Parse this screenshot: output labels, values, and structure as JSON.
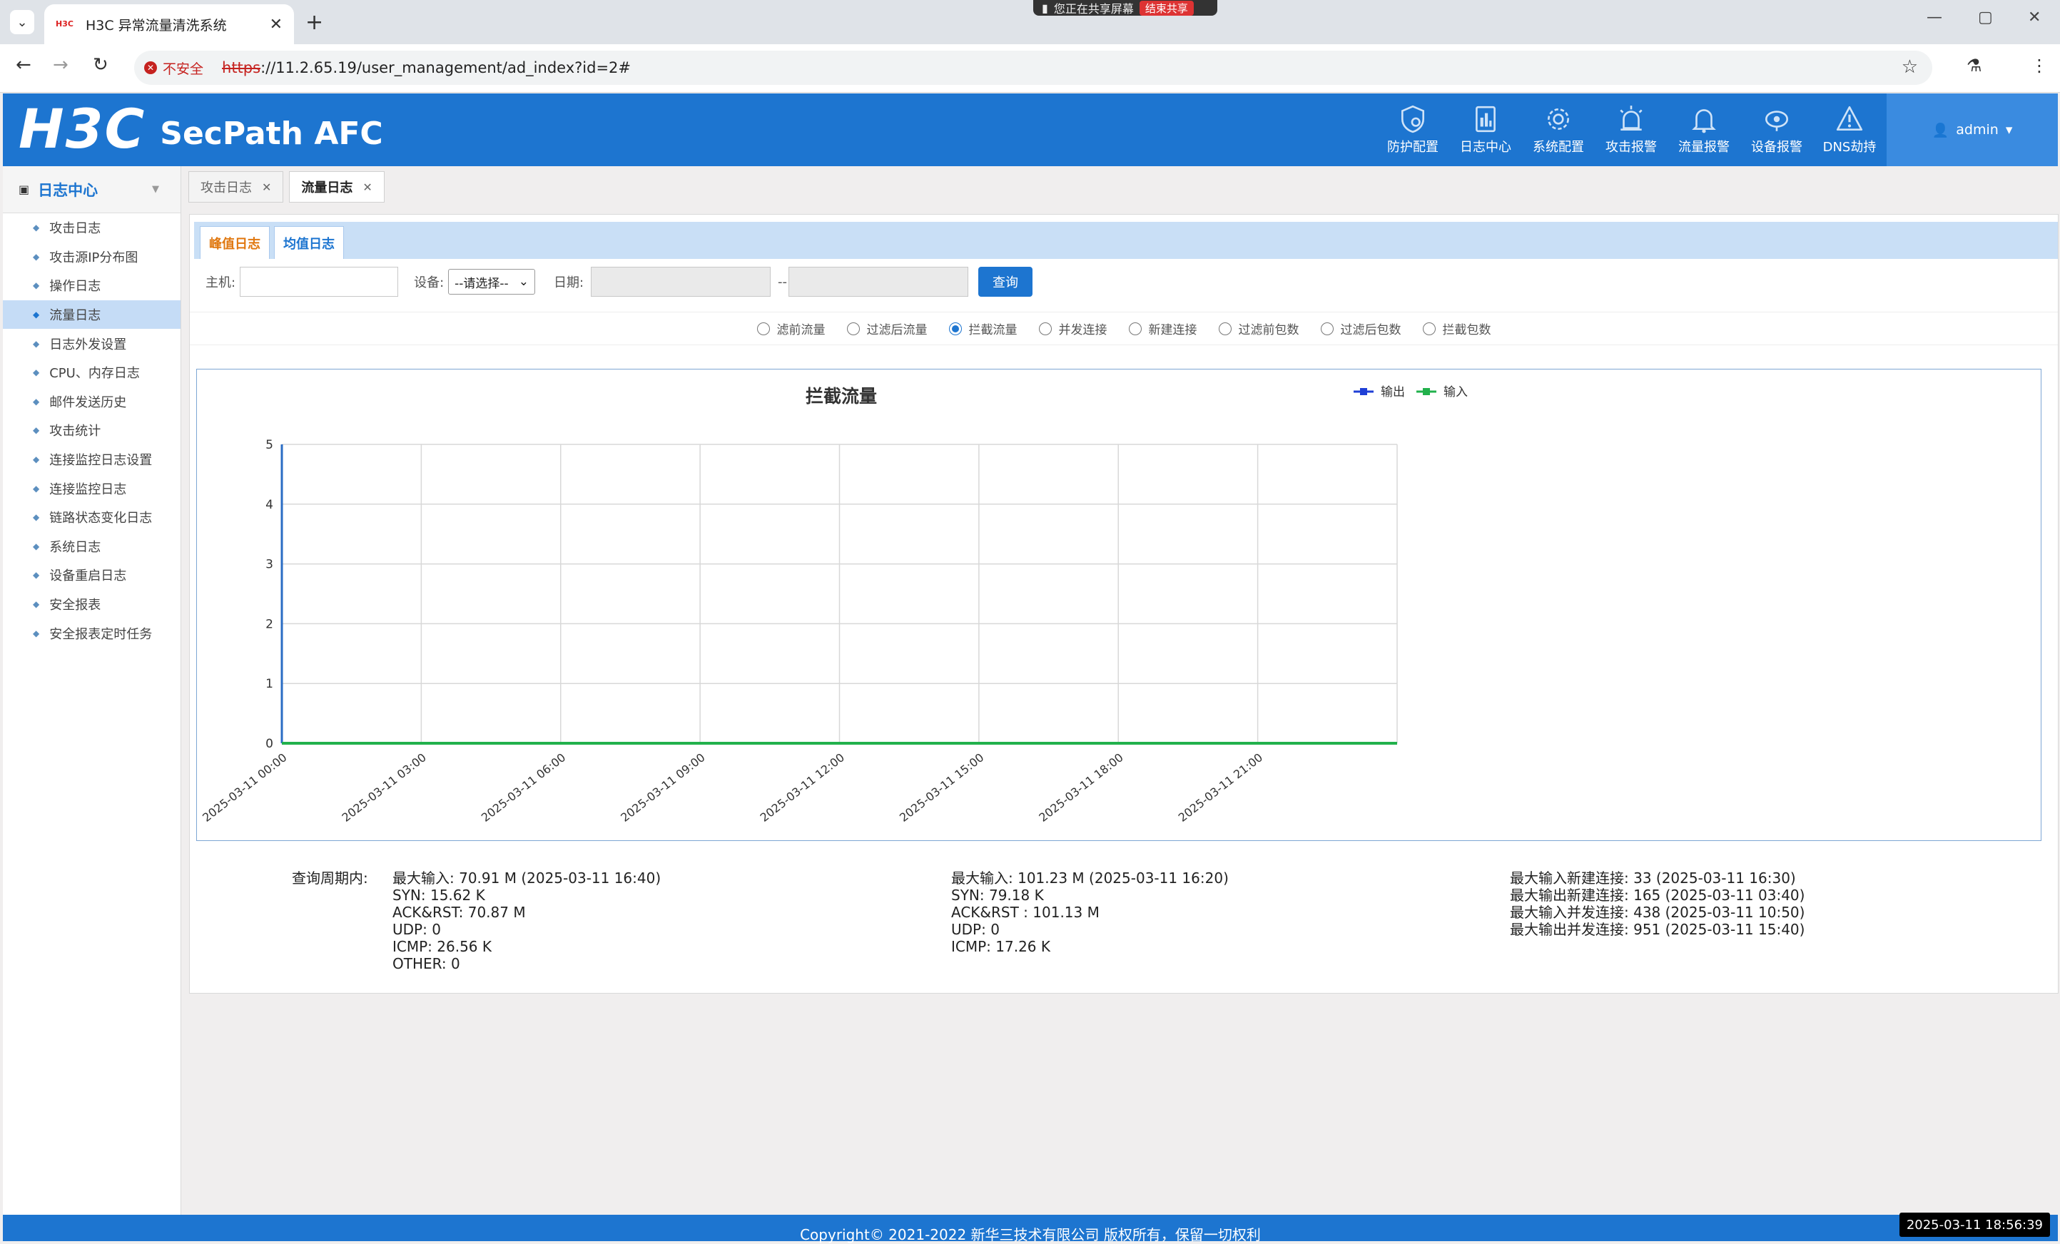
{
  "browser": {
    "tab_title": "H3C 异常流量清洗系统",
    "tab_favicon": "H3C",
    "new_tab": "+",
    "share_banner": "您正在共享屏幕",
    "share_stop": "结束共享",
    "insecure_label": "不安全",
    "url_scheme": "https",
    "url_rest": "://11.2.65.19/user_management/ad_index?id=2#"
  },
  "header": {
    "logo": "H3C",
    "product": "SecPath AFC",
    "nav": [
      {
        "label": "防护配置",
        "icon": "shield-gear-icon"
      },
      {
        "label": "日志中心",
        "icon": "log-book-icon"
      },
      {
        "label": "系统配置",
        "icon": "gear-icon"
      },
      {
        "label": "攻击报警",
        "icon": "alarm-light-icon"
      },
      {
        "label": "流量报警",
        "icon": "bell-icon"
      },
      {
        "label": "设备报警",
        "icon": "device-alert-icon"
      },
      {
        "label": "DNS劫持",
        "icon": "warning-triangle-icon"
      }
    ],
    "user": "admin"
  },
  "sidebar": {
    "title": "日志中心",
    "items": [
      {
        "label": "攻击日志"
      },
      {
        "label": "攻击源IP分布图"
      },
      {
        "label": "操作日志"
      },
      {
        "label": "流量日志"
      },
      {
        "label": "日志外发设置"
      },
      {
        "label": "CPU、内存日志"
      },
      {
        "label": "邮件发送历史"
      },
      {
        "label": "攻击统计"
      },
      {
        "label": "连接监控日志设置"
      },
      {
        "label": "连接监控日志"
      },
      {
        "label": "链路状态变化日志"
      },
      {
        "label": "系统日志"
      },
      {
        "label": "设备重启日志"
      },
      {
        "label": "安全报表"
      },
      {
        "label": "安全报表定时任务"
      }
    ],
    "active_index": 3
  },
  "page_tabs": [
    {
      "label": "攻击日志"
    },
    {
      "label": "流量日志"
    }
  ],
  "sub_tabs": [
    {
      "label": "峰值日志"
    },
    {
      "label": "均值日志"
    }
  ],
  "filters": {
    "host_label": "主机:",
    "host_value": "",
    "device_label": "设备:",
    "device_value": "--请选择--",
    "date_label": "日期:",
    "date_sep": "--",
    "date_from": "",
    "date_to": "",
    "query_button": "查询"
  },
  "radios": {
    "options": [
      "滤前流量",
      "过滤后流量",
      "拦截流量",
      "并发连接",
      "新建连接",
      "过滤前包数",
      "过滤后包数",
      "拦截包数"
    ],
    "selected_index": 2
  },
  "chart_data": {
    "type": "line",
    "title": "拦截流量",
    "x": [
      "2025-03-11 00:00",
      "2025-03-11 03:00",
      "2025-03-11 06:00",
      "2025-03-11 09:00",
      "2025-03-11 12:00",
      "2025-03-11 15:00",
      "2025-03-11 18:00",
      "2025-03-11 21:00"
    ],
    "ylim": [
      0,
      5
    ],
    "yticks": [
      "0",
      "1",
      "2",
      "3",
      "4",
      "5"
    ],
    "grid": true,
    "legend_position": "top-right",
    "series": [
      {
        "name": "输出",
        "color": "#1f3fd6",
        "values": [
          0,
          0,
          0,
          0,
          0,
          0,
          0,
          0
        ]
      },
      {
        "name": "输入",
        "color": "#22b14c",
        "values": [
          0,
          0,
          0,
          0,
          0,
          0,
          0,
          0
        ]
      }
    ]
  },
  "stats": {
    "period_label": "查询周期内:",
    "col1": [
      "最大输入: 70.91 M (2025-03-11 16:40)",
      "SYN: 15.62 K",
      "ACK&RST: 70.87 M",
      "UDP: 0",
      "ICMP: 26.56 K",
      "OTHER: 0"
    ],
    "col2": [
      "最大输入: 101.23 M (2025-03-11 16:20)",
      "SYN: 79.18 K",
      "ACK&RST : 101.13 M",
      "UDP: 0",
      "ICMP: 17.26 K"
    ],
    "col3": [
      "最大输入新建连接: 33 (2025-03-11 16:30)",
      "最大输出新建连接: 165 (2025-03-11 03:40)",
      "最大输入并发连接: 438 (2025-03-11 10:50)",
      "最大输出并发连接: 951 (2025-03-11 15:40)"
    ]
  },
  "footer": {
    "copyright": "Copyright© 2021-2022 新华三技术有限公司 版权所有，保留一切权利"
  },
  "clock": "2025-03-11 18:56:39",
  "colors": {
    "header_blue": "#1d75d0",
    "active_item": "#c5dcf6",
    "orange_tab": "#e07810"
  }
}
